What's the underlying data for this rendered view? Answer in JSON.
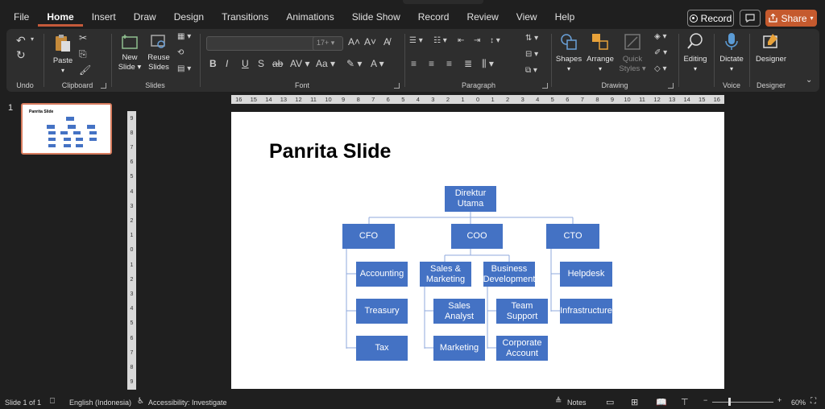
{
  "menu": [
    "File",
    "Home",
    "Insert",
    "Draw",
    "Design",
    "Transitions",
    "Animations",
    "Slide Show",
    "Record",
    "Review",
    "View",
    "Help"
  ],
  "active_menu": "Home",
  "header": {
    "record_label": "Record",
    "share_label": "Share"
  },
  "ribbon": {
    "groups": {
      "undo": "Undo",
      "clipboard": "Clipboard",
      "slides": "Slides",
      "font": "Font",
      "paragraph": "Paragraph",
      "drawing": "Drawing",
      "voice": "Voice",
      "designer": "Designer"
    },
    "paste": "Paste",
    "new_slide": "New Slide",
    "reuse_slides": "Reuse Slides",
    "font_size_placeholder": "17+",
    "shapes": "Shapes",
    "arrange": "Arrange",
    "quick_styles": "Quick Styles",
    "editing": "Editing",
    "dictate": "Dictate",
    "designer_btn": "Designer",
    "font_buttons": [
      "B",
      "I",
      "U",
      "S",
      "ab"
    ]
  },
  "thumbnails": [
    {
      "number": "1",
      "title": "Panrita Slide"
    }
  ],
  "ruler_h": [
    "16",
    "15",
    "14",
    "13",
    "12",
    "11",
    "10",
    "9",
    "8",
    "7",
    "6",
    "5",
    "4",
    "3",
    "2",
    "1",
    "0",
    "1",
    "2",
    "3",
    "4",
    "5",
    "6",
    "7",
    "8",
    "9",
    "10",
    "11",
    "12",
    "13",
    "14",
    "15",
    "16"
  ],
  "ruler_v": [
    "9",
    "8",
    "7",
    "6",
    "5",
    "4",
    "3",
    "2",
    "1",
    "0",
    "1",
    "2",
    "3",
    "4",
    "5",
    "6",
    "7",
    "8",
    "9"
  ],
  "slide": {
    "title": "Panrita Slide",
    "org": {
      "director": "Direktur Utama",
      "cfo": "CFO",
      "coo": "COO",
      "cto": "CTO",
      "accounting": "Accounting",
      "treasury": "Treasury",
      "tax": "Tax",
      "sales_marketing": "Sales & Marketing",
      "business_dev": "Business Development",
      "sales_analyst": "Sales Analyst",
      "marketing": "Marketing",
      "team_support": "Team Support",
      "corporate_account": "Corporate Account",
      "helpdesk": "Helpdesk",
      "infrastructure": "Infrastructure"
    }
  },
  "status": {
    "slide_count": "Slide 1 of 1",
    "language": "English (Indonesia)",
    "accessibility": "Accessibility: Investigate",
    "notes": "Notes",
    "zoom": "60%"
  },
  "colors": {
    "accent": "#c55a2e",
    "node": "#4472c4",
    "line": "#8faadc"
  }
}
